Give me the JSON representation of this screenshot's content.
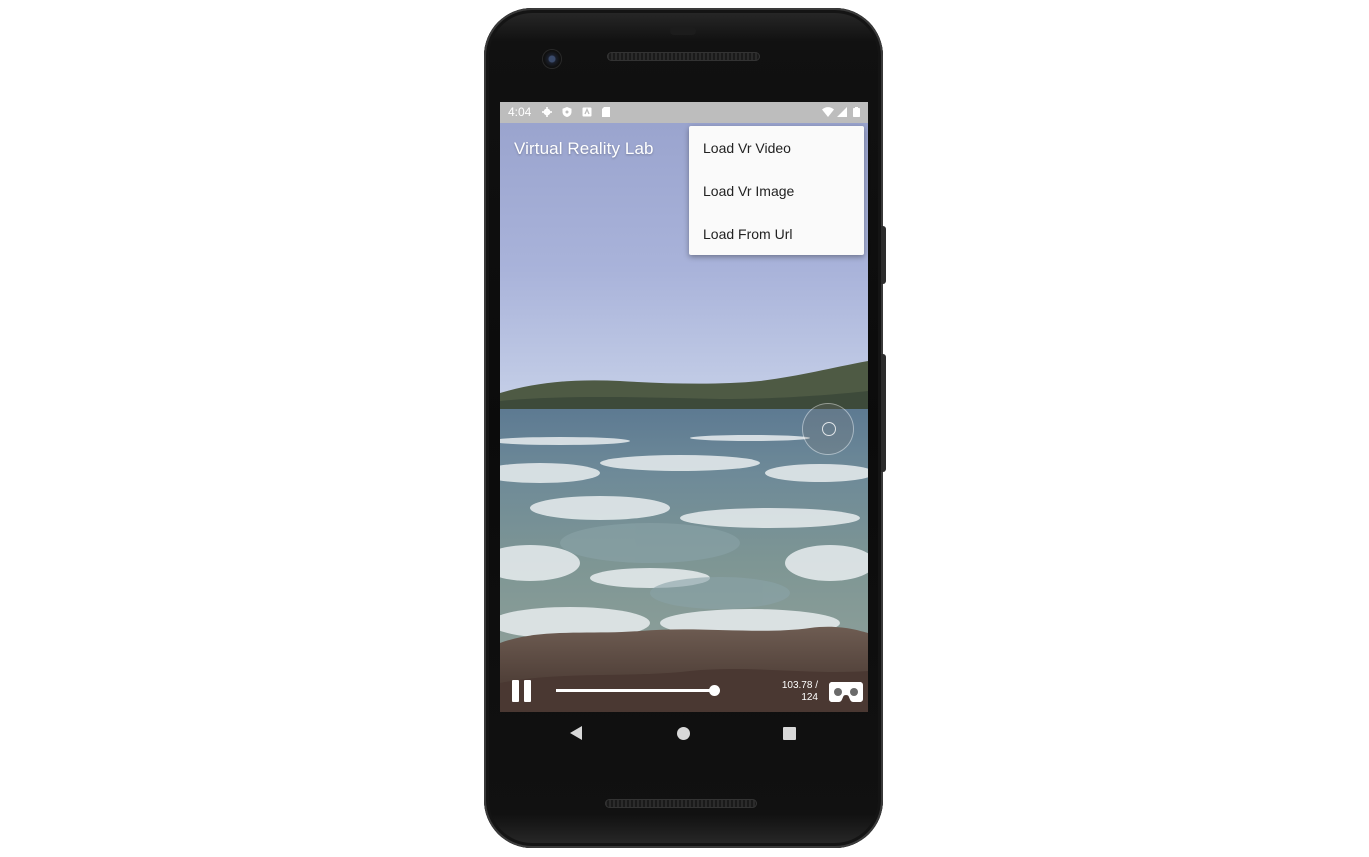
{
  "status_bar": {
    "time": "4:04",
    "left_icons": [
      "settings-icon",
      "shield-icon",
      "app-notification-icon",
      "sd-card-icon"
    ],
    "right_icons": [
      "wifi-icon",
      "signal-icon",
      "battery-icon"
    ]
  },
  "app_bar": {
    "title": "Virtual Reality Lab"
  },
  "overflow_menu": {
    "items": [
      {
        "label": "Load Vr Video"
      },
      {
        "label": "Load Vr Image"
      },
      {
        "label": "Load From Url"
      }
    ]
  },
  "player": {
    "progress_fraction": 0.837,
    "time_current": "103.78 /",
    "time_total": "124",
    "controls": [
      "pause-icon",
      "cardboard-vr-icon"
    ]
  },
  "navigation_bar": {
    "buttons": [
      "back-icon",
      "home-icon",
      "recents-icon"
    ]
  },
  "colors": {
    "status_bar": "#bdbdbd",
    "menu_background": "#fafafa",
    "menu_text": "#222222",
    "device_frame": "#111111"
  }
}
